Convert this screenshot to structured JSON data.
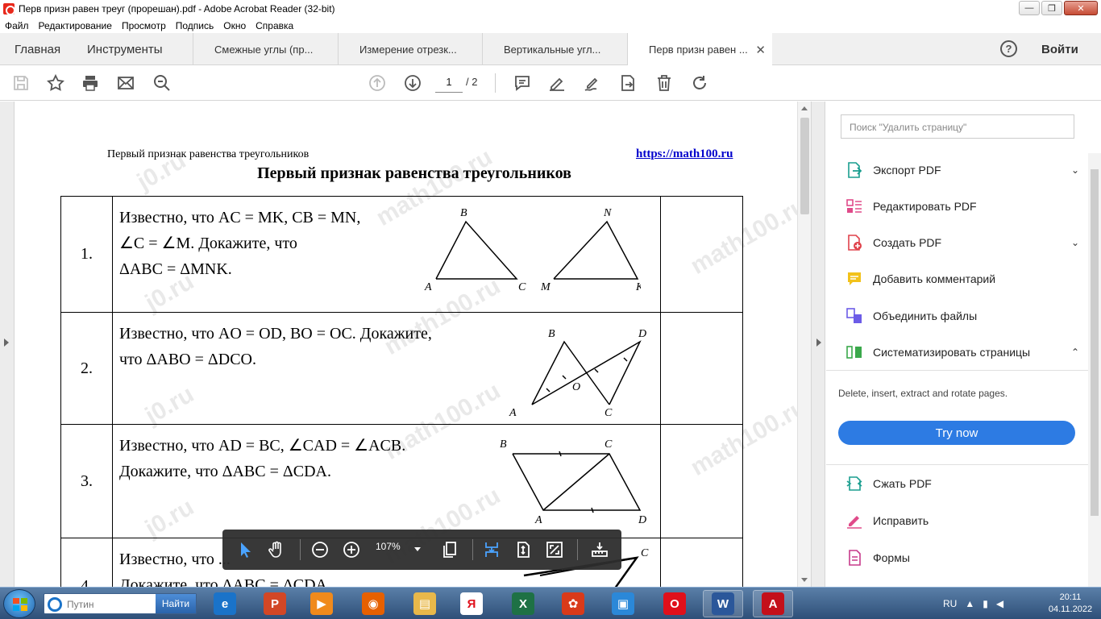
{
  "window": {
    "title": "Перв призн равен треуг (прорешан).pdf - Adobe Acrobat Reader (32-bit)",
    "controls": {
      "minimize": "—",
      "maximize": "❐",
      "close": "✕"
    }
  },
  "menu": [
    "Файл",
    "Редактирование",
    "Просмотр",
    "Подпись",
    "Окно",
    "Справка"
  ],
  "top_tabs": {
    "home": "Главная",
    "tools": "Инструменты"
  },
  "doc_tabs": [
    {
      "label": "Смежные углы (пр..."
    },
    {
      "label": "Измерение отрезк..."
    },
    {
      "label": "Вертикальные угл..."
    },
    {
      "label": "Перв призн равен ..."
    }
  ],
  "doc_tab_close": "✕",
  "help_label": "?",
  "signin_label": "Войти",
  "toolbar": {
    "page_current": "1",
    "page_total": "/ 2"
  },
  "document": {
    "header_left": "Первый признак равенства треугольников",
    "header_right": "https://math100.ru",
    "title": "Первый признак равенства треугольников",
    "rows": [
      {
        "num": "1.",
        "lines": [
          "Известно, что AC = MK, CB = MN,",
          "∠C = ∠M. Докажите, что",
          "ΔABC = ΔMNK."
        ],
        "labels": {
          "B": "B",
          "A": "A",
          "C": "C",
          "N": "N",
          "M": "M",
          "K": "K"
        }
      },
      {
        "num": "2.",
        "lines": [
          "Известно, что AO = OD, BO = OC. Докажите,",
          "что ΔABO = ΔDCO."
        ],
        "labels": {
          "B": "B",
          "D": "D",
          "O": "O",
          "A": "A",
          "C": "C"
        }
      },
      {
        "num": "3.",
        "lines": [
          "Известно, что AD = BC, ∠CAD = ∠ACB.",
          "Докажите, что ΔABC = ΔCDA."
        ],
        "labels": {
          "B": "B",
          "C": "C",
          "A": "A",
          "D": "D"
        }
      },
      {
        "num": "4.",
        "lines": [
          "Известно, что ...",
          "Докажите, что ΔABC = ΔCDA."
        ],
        "labels": {
          "C": "C"
        }
      }
    ],
    "watermarks": [
      "math100.ru",
      "j0.ru"
    ]
  },
  "float_toolbar": {
    "zoom": "107%"
  },
  "right_panel": {
    "search_placeholder": "Поиск \"Удалить страницу\"",
    "items": [
      {
        "label": "Экспорт PDF",
        "icon": "export-pdf-icon",
        "color": "#1a9e8f",
        "chevron": "⌄"
      },
      {
        "label": "Редактировать PDF",
        "icon": "edit-pdf-icon",
        "color": "#e04b8a"
      },
      {
        "label": "Создать PDF",
        "icon": "create-pdf-icon",
        "color": "#e0424b",
        "chevron": "⌄"
      },
      {
        "label": "Добавить комментарий",
        "icon": "comment-icon",
        "color": "#f2c21b"
      },
      {
        "label": "Объединить файлы",
        "icon": "combine-files-icon",
        "color": "#6c5ce7"
      },
      {
        "label": "Систематизировать страницы",
        "icon": "organize-pages-icon",
        "color": "#3aa84b",
        "chevron": "⌃"
      }
    ],
    "description": "Delete, insert, extract and rotate pages.",
    "try_now": "Try now",
    "items_bottom": [
      {
        "label": "Сжать PDF",
        "icon": "compress-pdf-icon",
        "color": "#1a9e8f"
      },
      {
        "label": "Исправить",
        "icon": "fill-sign-icon",
        "color": "#e04b8a"
      },
      {
        "label": "Формы",
        "icon": "forms-icon",
        "color": "#c73a8a"
      }
    ]
  },
  "taskbar": {
    "search_placeholder": "Путин",
    "search_button": "Найти",
    "lang": "RU",
    "time": "20:11",
    "date": "04.11.2022",
    "apps": [
      {
        "name": "internet-explorer",
        "color": "#1a73c9",
        "glyph": "e"
      },
      {
        "name": "powerpoint",
        "color": "#d24726",
        "glyph": "P"
      },
      {
        "name": "media-player",
        "color": "#f08a1c",
        "glyph": "▶"
      },
      {
        "name": "firefox",
        "color": "#e66000",
        "glyph": "◉"
      },
      {
        "name": "explorer",
        "color": "#e8b84a",
        "glyph": "▤"
      },
      {
        "name": "yandex",
        "color": "#ffffff",
        "glyph": "Я"
      },
      {
        "name": "excel",
        "color": "#1e7145",
        "glyph": "X"
      },
      {
        "name": "media-app",
        "color": "#d93a1a",
        "glyph": "✿"
      },
      {
        "name": "store-app",
        "color": "#2b88d8",
        "glyph": "▣"
      },
      {
        "name": "opera",
        "color": "#e0101b",
        "glyph": "O"
      },
      {
        "name": "word",
        "color": "#2b579a",
        "glyph": "W"
      },
      {
        "name": "acrobat",
        "color": "#c4101a",
        "glyph": "A"
      }
    ]
  }
}
